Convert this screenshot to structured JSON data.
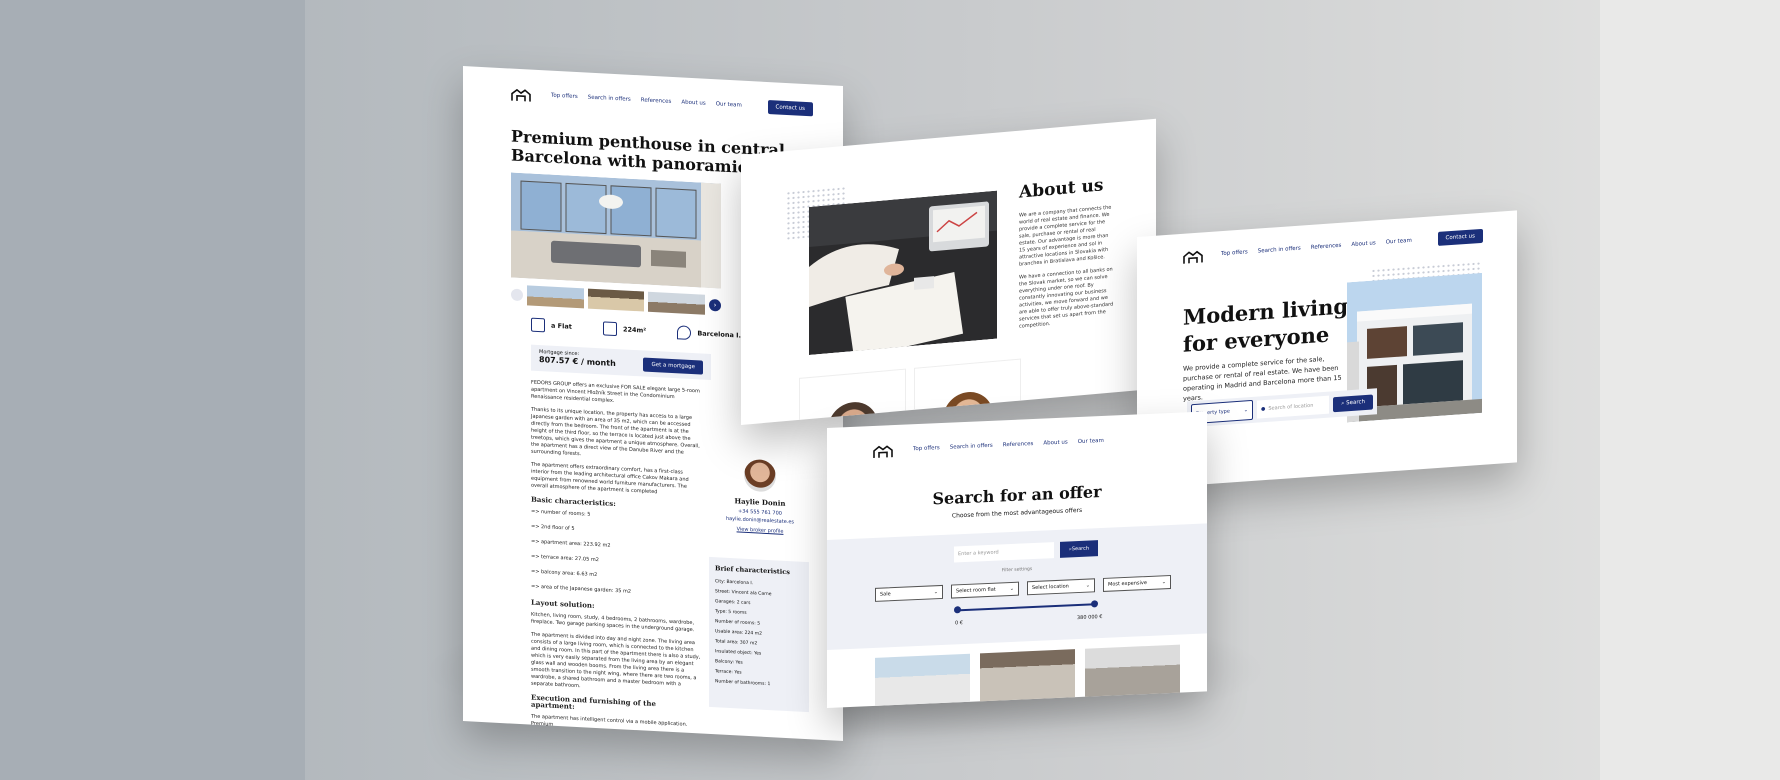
{
  "nav": {
    "items": [
      "Top offers",
      "Search in offers",
      "References",
      "About us",
      "Our team"
    ],
    "contact_label": "Contact us"
  },
  "detail": {
    "title": "Premium penthouse in central Barcelona with panoramic views",
    "specs": {
      "type": "a Flat",
      "area": "224m²",
      "location": "Barcelona I."
    },
    "mortgage_label": "Mortgage since:",
    "mortgage_value": "807.57 € / month",
    "mortgage_button": "Get a mortgage",
    "paragraphs": [
      "FEDORS GROUP offers an exclusive FOR SALE elegant large 5-room apartment on Vincent Hložník Street in the Condominium Renaissance residential complex.",
      "Thanks to its unique location, the property has access to a large Japanese garden with an area of 35 m2, which can be accessed directly from the bedroom. The front of the apartment is at the height of the third floor, so the terrace is located just above the treetops, which gives the apartment a unique atmosphere. Overall, the apartment has a direct view of the Danube River and the surrounding forests.",
      "The apartment offers extraordinary comfort, has a first-class interior from the leading architectural office Cakov Makara and equipment from renowned world furniture manufacturers. The overall atmosphere of the apartment is completed"
    ],
    "basic_heading": "Basic characteristics:",
    "basic_items": [
      "=> number of rooms: 5",
      "=> 2nd floor of 5",
      "=> apartment area: 223.92 m2",
      "=> terrace area: 27.05 m2",
      "=> balcony area: 6.63 m2",
      "=> area of the Japanese garden: 35 m2"
    ],
    "layout_heading": "Layout solution:",
    "layout_text": "Kitchen, living room, study, 4 bedrooms, 2 bathrooms, wardrobe, fireplace. Two garage parking spaces in the underground garage.",
    "layout_text2": "The apartment is divided into day and night zone. The living area consists of a large living room, which is connected to the kitchen and dining room. In this part of the apartment there is also a study, which is very easily separated from the living area by an elegant glass wall and wooden booms. From the living area there is a smooth transition to the night wing, where there are two rooms, a wardrobe, a shared bathroom and a master bedroom with a separate bathroom.",
    "exec_heading": "Execution and furnishing of the apartment:",
    "exec_text": "The apartment has intelligent control via a mobile application. Premium",
    "agent": {
      "name": "Haylie Donin",
      "phone": "+34 555 761 700",
      "email": "haylie.donin@realestate.es",
      "profile_link": "View broker profile"
    },
    "brief_heading": "Brief characteristics",
    "brief": [
      "City: Barcelona I.",
      "Street: Vincent ala Carne",
      "Garages: 2 cars",
      "Type: 5 rooms",
      "Number of rooms: 5",
      "Usable area: 224 m2",
      "Total area: 307 m2",
      "Insulated object: Yes",
      "Balcony: Yes",
      "Terrace: Yes",
      "Number of bathrooms: 1"
    ]
  },
  "about": {
    "title": "About us",
    "p1": "We are a company that connects the world of real estate and finance. We provide a complete service for the sale, purchase or rental of real estate. Our advantage is more than 15 years of experience and sol in attractive locations in Slovakia with branches in Bratislava and Košice.",
    "p2": "We have a connection to all banks on the Slovak market, so we can solve everything under one roof. By constantly innovating our business activities, we move forward and we are able to offer truly above-standard services that set us apart from the competition."
  },
  "hero": {
    "title_line1": "Modern living",
    "title_line2": "for everyone",
    "subtitle": "We provide a complete service for the sale, purchase or rental of real estate. We have been operating in Madrid and Barcelona more than 15 years.",
    "property_type": "Property type",
    "location_placeholder": "Search of location",
    "search_label": "Search"
  },
  "search_page": {
    "title": "Search for an offer",
    "subtitle": "Choose from the most advantageous offers",
    "keyword_placeholder": "Enter a keyword",
    "search_label": "Search",
    "filter_settings": "Filter settings",
    "filters": [
      "Sale",
      "Select room flat",
      "Select location",
      "Most expensive"
    ],
    "range_min": "0 €",
    "range_max": "380 000 €"
  },
  "colors": {
    "brand": "#1b2f7a",
    "panel": "#eef0f6"
  }
}
